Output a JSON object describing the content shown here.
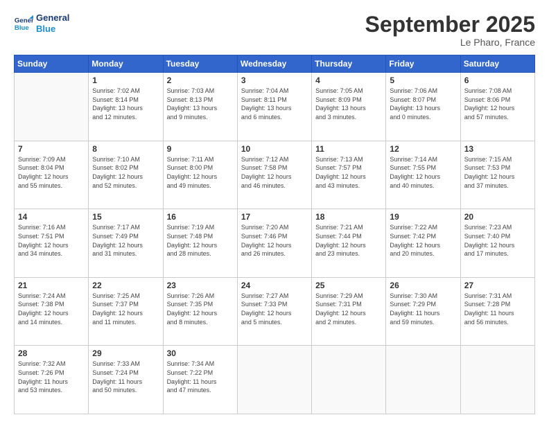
{
  "logo": {
    "line1": "General",
    "line2": "Blue"
  },
  "title": "September 2025",
  "location": "Le Pharo, France",
  "days_header": [
    "Sunday",
    "Monday",
    "Tuesday",
    "Wednesday",
    "Thursday",
    "Friday",
    "Saturday"
  ],
  "weeks": [
    [
      {
        "day": "",
        "info": ""
      },
      {
        "day": "1",
        "info": "Sunrise: 7:02 AM\nSunset: 8:14 PM\nDaylight: 13 hours\nand 12 minutes."
      },
      {
        "day": "2",
        "info": "Sunrise: 7:03 AM\nSunset: 8:13 PM\nDaylight: 13 hours\nand 9 minutes."
      },
      {
        "day": "3",
        "info": "Sunrise: 7:04 AM\nSunset: 8:11 PM\nDaylight: 13 hours\nand 6 minutes."
      },
      {
        "day": "4",
        "info": "Sunrise: 7:05 AM\nSunset: 8:09 PM\nDaylight: 13 hours\nand 3 minutes."
      },
      {
        "day": "5",
        "info": "Sunrise: 7:06 AM\nSunset: 8:07 PM\nDaylight: 13 hours\nand 0 minutes."
      },
      {
        "day": "6",
        "info": "Sunrise: 7:08 AM\nSunset: 8:06 PM\nDaylight: 12 hours\nand 57 minutes."
      }
    ],
    [
      {
        "day": "7",
        "info": "Sunrise: 7:09 AM\nSunset: 8:04 PM\nDaylight: 12 hours\nand 55 minutes."
      },
      {
        "day": "8",
        "info": "Sunrise: 7:10 AM\nSunset: 8:02 PM\nDaylight: 12 hours\nand 52 minutes."
      },
      {
        "day": "9",
        "info": "Sunrise: 7:11 AM\nSunset: 8:00 PM\nDaylight: 12 hours\nand 49 minutes."
      },
      {
        "day": "10",
        "info": "Sunrise: 7:12 AM\nSunset: 7:58 PM\nDaylight: 12 hours\nand 46 minutes."
      },
      {
        "day": "11",
        "info": "Sunrise: 7:13 AM\nSunset: 7:57 PM\nDaylight: 12 hours\nand 43 minutes."
      },
      {
        "day": "12",
        "info": "Sunrise: 7:14 AM\nSunset: 7:55 PM\nDaylight: 12 hours\nand 40 minutes."
      },
      {
        "day": "13",
        "info": "Sunrise: 7:15 AM\nSunset: 7:53 PM\nDaylight: 12 hours\nand 37 minutes."
      }
    ],
    [
      {
        "day": "14",
        "info": "Sunrise: 7:16 AM\nSunset: 7:51 PM\nDaylight: 12 hours\nand 34 minutes."
      },
      {
        "day": "15",
        "info": "Sunrise: 7:17 AM\nSunset: 7:49 PM\nDaylight: 12 hours\nand 31 minutes."
      },
      {
        "day": "16",
        "info": "Sunrise: 7:19 AM\nSunset: 7:48 PM\nDaylight: 12 hours\nand 28 minutes."
      },
      {
        "day": "17",
        "info": "Sunrise: 7:20 AM\nSunset: 7:46 PM\nDaylight: 12 hours\nand 26 minutes."
      },
      {
        "day": "18",
        "info": "Sunrise: 7:21 AM\nSunset: 7:44 PM\nDaylight: 12 hours\nand 23 minutes."
      },
      {
        "day": "19",
        "info": "Sunrise: 7:22 AM\nSunset: 7:42 PM\nDaylight: 12 hours\nand 20 minutes."
      },
      {
        "day": "20",
        "info": "Sunrise: 7:23 AM\nSunset: 7:40 PM\nDaylight: 12 hours\nand 17 minutes."
      }
    ],
    [
      {
        "day": "21",
        "info": "Sunrise: 7:24 AM\nSunset: 7:38 PM\nDaylight: 12 hours\nand 14 minutes."
      },
      {
        "day": "22",
        "info": "Sunrise: 7:25 AM\nSunset: 7:37 PM\nDaylight: 12 hours\nand 11 minutes."
      },
      {
        "day": "23",
        "info": "Sunrise: 7:26 AM\nSunset: 7:35 PM\nDaylight: 12 hours\nand 8 minutes."
      },
      {
        "day": "24",
        "info": "Sunrise: 7:27 AM\nSunset: 7:33 PM\nDaylight: 12 hours\nand 5 minutes."
      },
      {
        "day": "25",
        "info": "Sunrise: 7:29 AM\nSunset: 7:31 PM\nDaylight: 12 hours\nand 2 minutes."
      },
      {
        "day": "26",
        "info": "Sunrise: 7:30 AM\nSunset: 7:29 PM\nDaylight: 11 hours\nand 59 minutes."
      },
      {
        "day": "27",
        "info": "Sunrise: 7:31 AM\nSunset: 7:28 PM\nDaylight: 11 hours\nand 56 minutes."
      }
    ],
    [
      {
        "day": "28",
        "info": "Sunrise: 7:32 AM\nSunset: 7:26 PM\nDaylight: 11 hours\nand 53 minutes."
      },
      {
        "day": "29",
        "info": "Sunrise: 7:33 AM\nSunset: 7:24 PM\nDaylight: 11 hours\nand 50 minutes."
      },
      {
        "day": "30",
        "info": "Sunrise: 7:34 AM\nSunset: 7:22 PM\nDaylight: 11 hours\nand 47 minutes."
      },
      {
        "day": "",
        "info": ""
      },
      {
        "day": "",
        "info": ""
      },
      {
        "day": "",
        "info": ""
      },
      {
        "day": "",
        "info": ""
      }
    ]
  ]
}
